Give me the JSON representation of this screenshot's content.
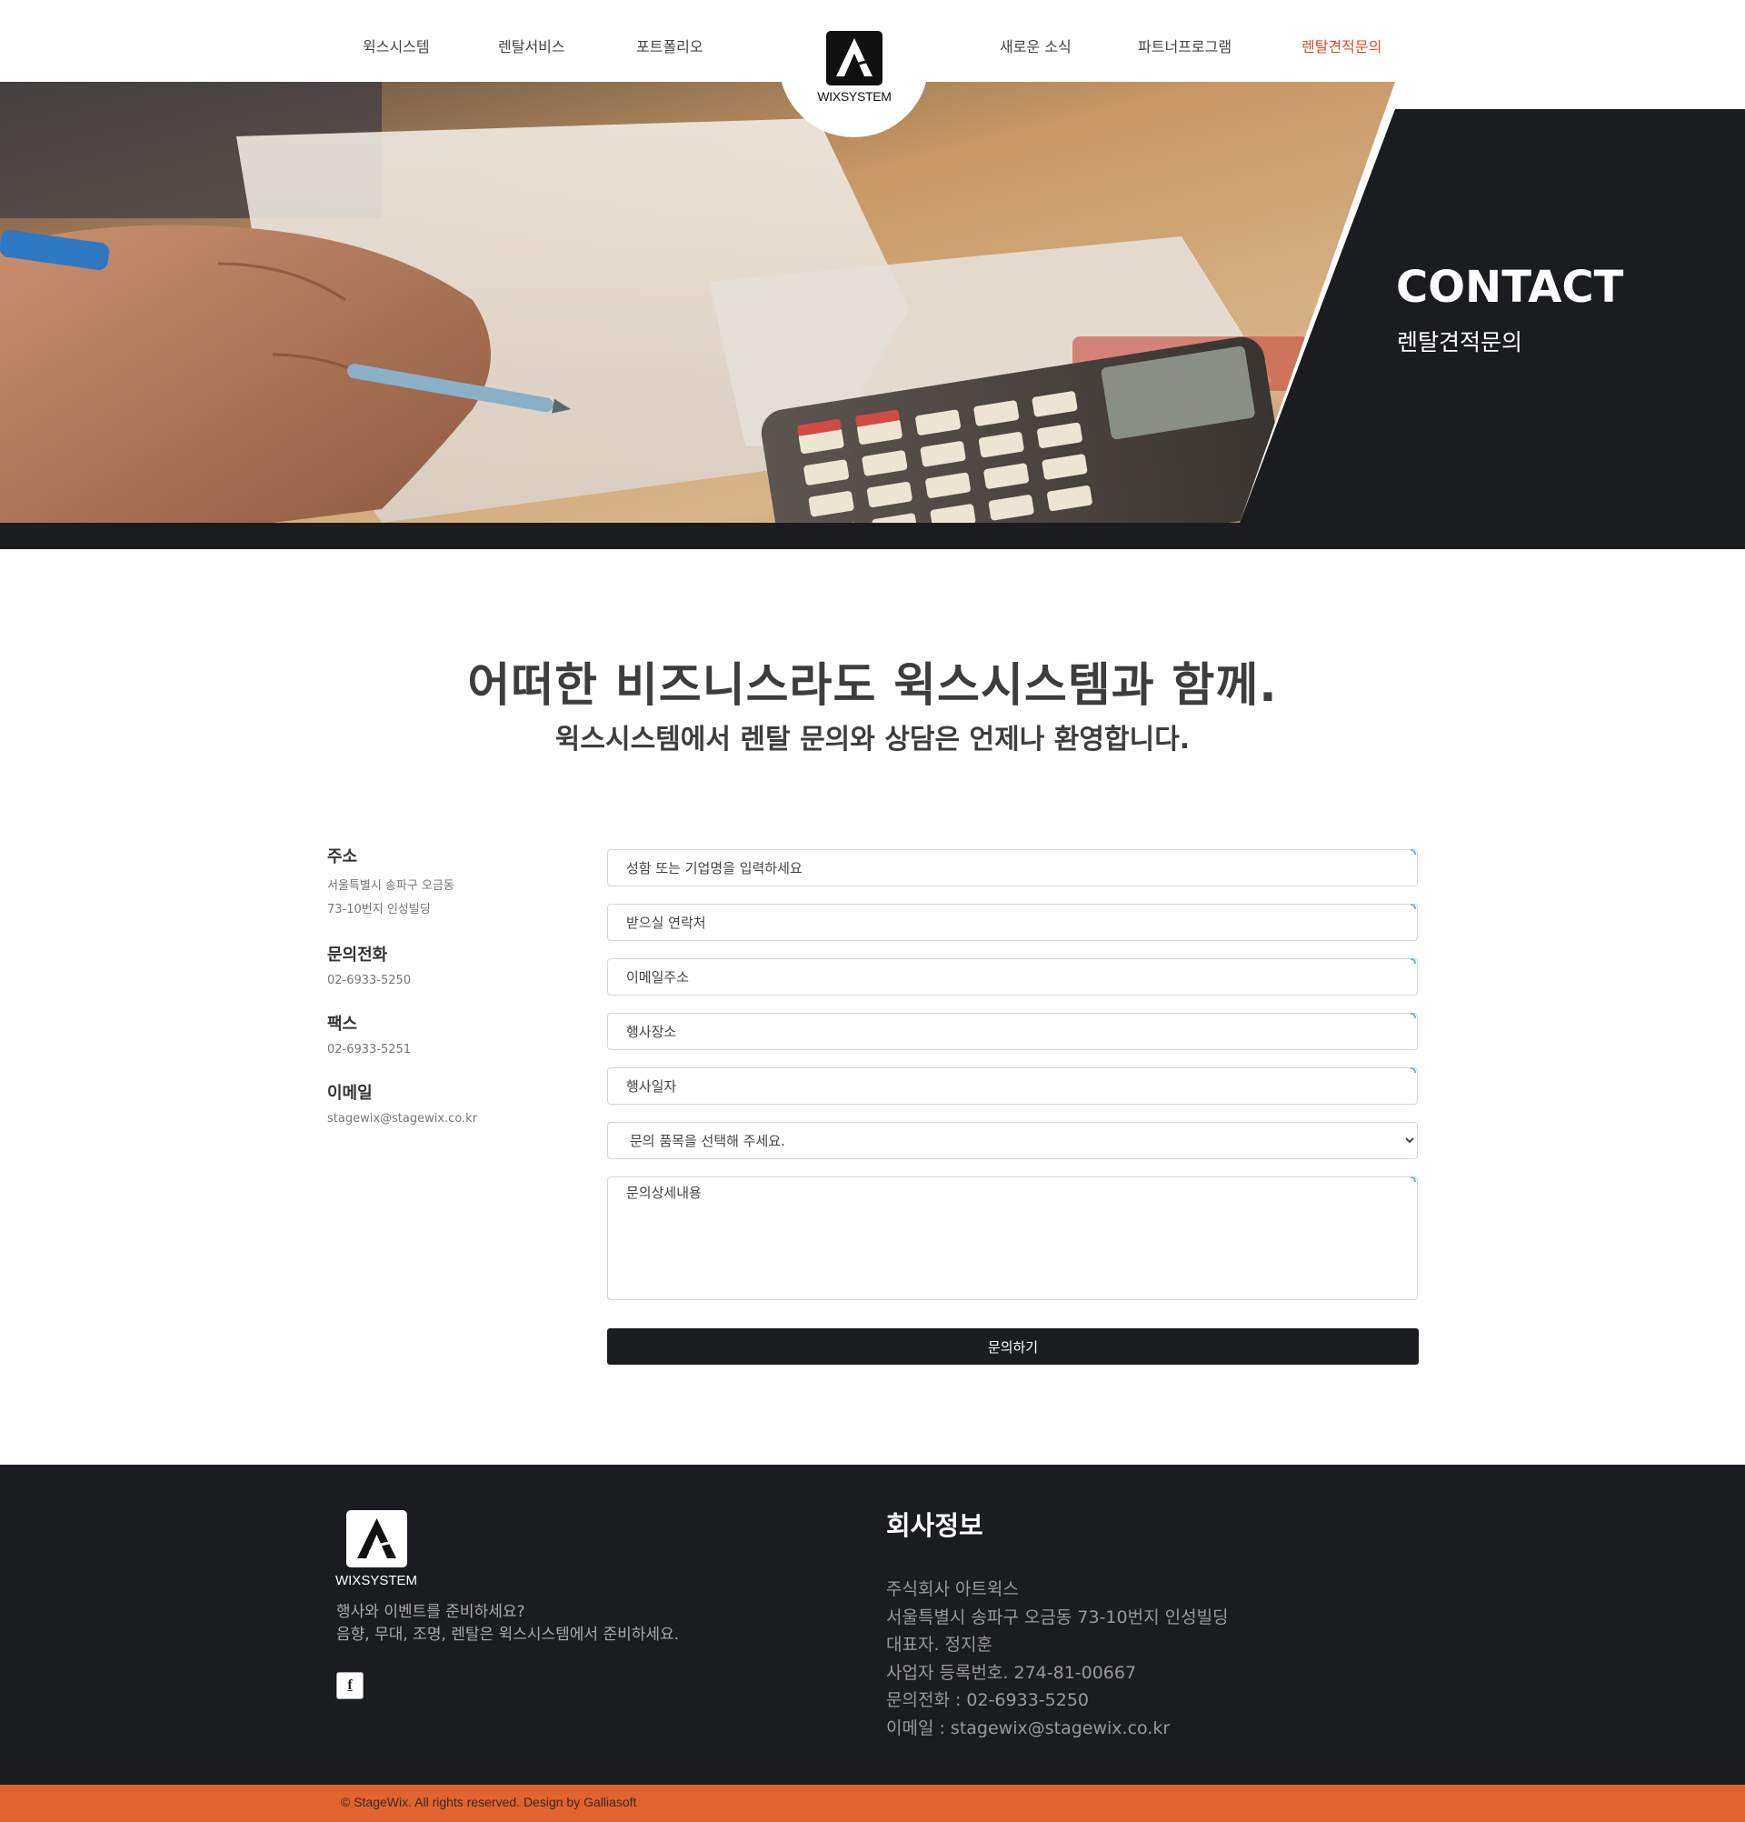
{
  "nav": {
    "items": [
      {
        "label": "윅스시스템"
      },
      {
        "label": "렌탈서비스"
      },
      {
        "label": "포트폴리오"
      },
      {
        "label": "새로운 소식"
      },
      {
        "label": "파트너프로그램"
      },
      {
        "label": "렌탈견적문의"
      }
    ],
    "active_color": "#e0492b"
  },
  "logo": {
    "text": "WIXSYSTEM",
    "icon": "a-logo-icon"
  },
  "hero": {
    "title": "CONTACT",
    "subtitle": "렌탈견적문의",
    "panel_color": "#1b1c1f"
  },
  "intro": {
    "headline": "어떠한 비즈니스라도 윅스시스템과 함께.",
    "subline": "윅스시스템에서 렌탈 문의와 상담은 언제나 환영합니다."
  },
  "contact_info": {
    "address": {
      "label": "주소",
      "line1": "서울특별시 송파구 오금동",
      "line2": "73-10번지 인성빌딩"
    },
    "phone": {
      "label": "문의전화",
      "value": "02-6933-5250"
    },
    "fax": {
      "label": "팩스",
      "value": "02-6933-5251"
    },
    "email": {
      "label": "이메일",
      "value": "stagewix@stagewix.co.kr"
    }
  },
  "form": {
    "name_placeholder": "성함 또는 기업명을 입력하세요",
    "contact_placeholder": "받으실 연락처",
    "email_placeholder": "이메일주소",
    "venue_placeholder": "행사장소",
    "date_placeholder": "행사일자",
    "category_selected": "문의 품목을 선택해 주세요.",
    "details_placeholder": "문의상세내용",
    "submit_label": "문의하기"
  },
  "footer": {
    "logo_text": "WIXSYSTEM",
    "tagline1": "행사와 이벤트를 준비하세요?",
    "tagline2": "음향, 무대, 조명, 렌탈은 윅스시스템에서 준비하세요.",
    "social_icon": "facebook-icon",
    "social_glyph": "f",
    "company_heading": "회사정보",
    "company_lines": [
      "주식회사 아트윅스",
      "서울특별시 송파구 오금동 73-10번지 인성빌딩",
      "대표자. 정지훈",
      "사업자 등록번호. 274-81-00667",
      "문의전화 : 02-6933-5250",
      "이메일 : stagewix@stagewix.co.kr"
    ],
    "copyright": "© StageWix. All rights reserved. Design by Galliasoft",
    "accent_color": "#e06330"
  }
}
